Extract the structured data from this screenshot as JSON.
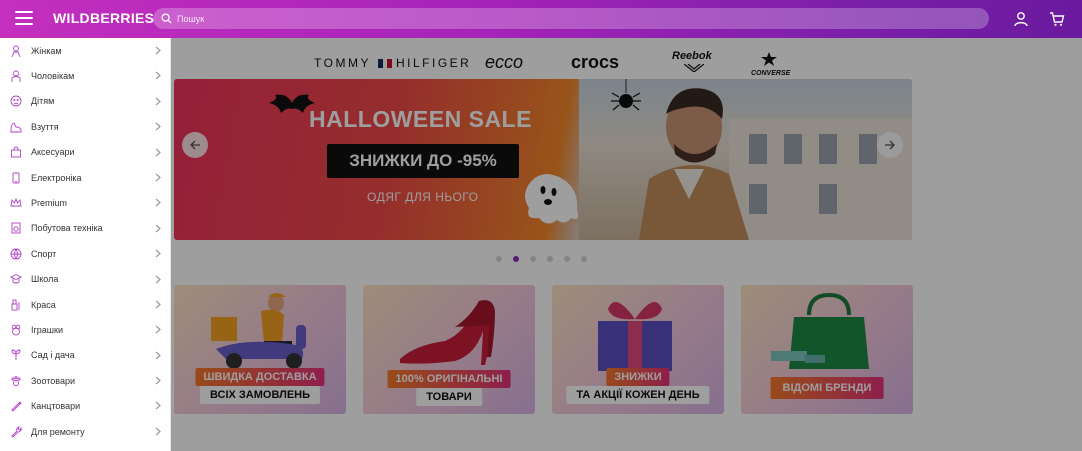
{
  "header": {
    "logo": "WILDBERRIES",
    "search_placeholder": "Пошук",
    "colors": {
      "gradient_start": "#c42fbf",
      "gradient_end": "#6a1a9e"
    },
    "icons": [
      "menu-icon",
      "search-icon",
      "user-icon",
      "cart-icon"
    ]
  },
  "sidebar": {
    "items": [
      {
        "label": "Жінкам",
        "icon": "woman-icon"
      },
      {
        "label": "Чоловікам",
        "icon": "man-icon"
      },
      {
        "label": "Дітям",
        "icon": "child-icon"
      },
      {
        "label": "Взуття",
        "icon": "shoe-icon"
      },
      {
        "label": "Аксесуари",
        "icon": "bag-icon"
      },
      {
        "label": "Електроніка",
        "icon": "phone-icon"
      },
      {
        "label": "Premium",
        "icon": "crown-icon"
      },
      {
        "label": "Побутова техніка",
        "icon": "appliance-icon"
      },
      {
        "label": "Спорт",
        "icon": "ball-icon"
      },
      {
        "label": "Школа",
        "icon": "school-icon"
      },
      {
        "label": "Краса",
        "icon": "beauty-icon"
      },
      {
        "label": "Іграшки",
        "icon": "toy-icon"
      },
      {
        "label": "Сад і дача",
        "icon": "garden-icon"
      },
      {
        "label": "Зоотовари",
        "icon": "paw-icon"
      },
      {
        "label": "Канцтовари",
        "icon": "pen-icon"
      },
      {
        "label": "Для ремонту",
        "icon": "wrench-icon"
      }
    ]
  },
  "brands": [
    "TOMMY",
    "HILFIGER",
    "ecco",
    "crocs",
    "Reebok",
    "CONVERSE"
  ],
  "banner": {
    "title": "HALLOWEEN SALE",
    "discount": "ЗНИЖКИ ДО -95%",
    "subtitle": "ОДЯГ ДЛЯ НЬОГО",
    "active_slide": 2,
    "slide_count": 6
  },
  "promos": [
    {
      "tag": "ШВИДКА ДОСТАВКА",
      "label": "ВСІХ ЗАМОВЛЕНЬ"
    },
    {
      "tag": "100% ОРИГІНАЛЬНІ",
      "label": "ТОВАРИ"
    },
    {
      "tag": "ЗНИЖКИ",
      "label": "ТА АКЦІЇ КОЖЕН ДЕНЬ"
    },
    {
      "tag": "ВІДОМІ БРЕНДИ",
      "label": ""
    }
  ]
}
